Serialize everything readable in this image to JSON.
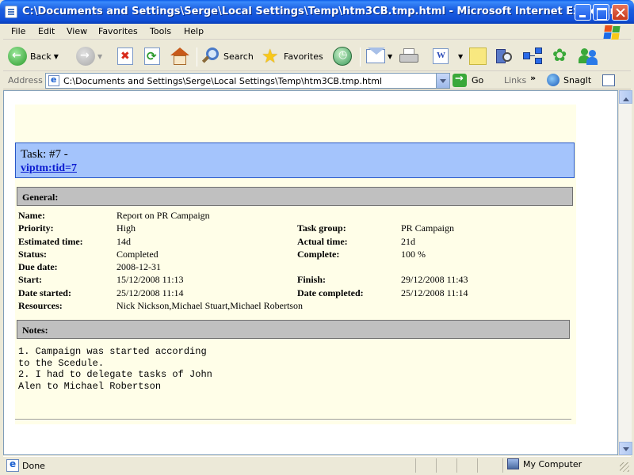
{
  "window": {
    "title": "C:\\Documents and Settings\\Serge\\Local Settings\\Temp\\htm3CB.tmp.html - Microsoft Internet Explorer"
  },
  "menu": [
    "File",
    "Edit",
    "View",
    "Favorites",
    "Tools",
    "Help"
  ],
  "toolbar": {
    "back_label": "Back",
    "search_label": "Search",
    "favorites_label": "Favorites"
  },
  "address": {
    "label": "Address",
    "url": "C:\\Documents and Settings\\Serge\\Local Settings\\Temp\\htm3CB.tmp.html",
    "go_label": "Go",
    "links_label": "Links",
    "snagit_label": "SnagIt"
  },
  "task": {
    "title": "Task: #7 -",
    "link": "viptm:tid=7",
    "general_header": "General:",
    "fields": {
      "name_label": "Name:",
      "name": "Report on PR Campaign",
      "priority_label": "Priority:",
      "priority": "High",
      "task_group_label": "Task group:",
      "task_group": "PR Campaign",
      "estimated_label": "Estimated time:",
      "estimated": "14d",
      "actual_label": "Actual time:",
      "actual": "21d",
      "status_label": "Status:",
      "status": "Completed",
      "complete_label": "Complete:",
      "complete": "100 %",
      "due_label": "Due date:",
      "due": "2008-12-31",
      "start_label": "Start:",
      "start": "15/12/2008 11:13",
      "finish_label": "Finish:",
      "finish": "29/12/2008 11:43",
      "date_started_label": "Date started:",
      "date_started": "25/12/2008 11:14",
      "date_completed_label": "Date completed:",
      "date_completed": "25/12/2008 11:14",
      "resources_label": "Resources:",
      "resources": "Nick Nickson,Michael Stuart,Michael Robertson"
    },
    "notes_header": "Notes:",
    "notes": "1. Campaign was started according\nto the Scedule.\n2. I had to delegate tasks of John\nAlen to Michael Robertson"
  },
  "status": {
    "text": "Done",
    "zone": "My Computer"
  }
}
